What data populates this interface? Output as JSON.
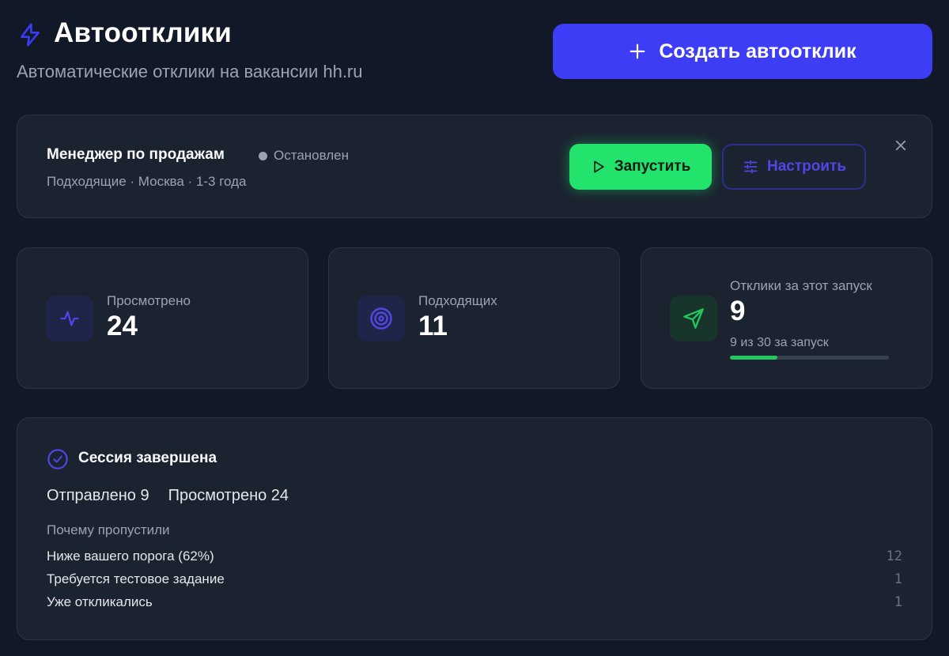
{
  "header": {
    "title": "Автоотклики",
    "subtitle": "Автоматические отклики на вакансии hh.ru",
    "create_label": "Создать автоотклик"
  },
  "job": {
    "title": "Менеджер по продажам",
    "status": "Остановлен",
    "meta": "Подходящие · Москва · 1-3 года",
    "run_label": "Запустить",
    "configure_label": "Настроить"
  },
  "stats": [
    {
      "label": "Просмотрено",
      "value": "24",
      "icon": "activity-icon"
    },
    {
      "label": "Подходящих",
      "value": "11",
      "icon": "target-icon"
    },
    {
      "label": "Отклики за этот запуск",
      "value": "9",
      "note": "9 из 30 за запуск",
      "progress": 0.3,
      "icon": "send-icon"
    }
  ],
  "session": {
    "title": "Сессия завершена",
    "sent": "Отправлено 9",
    "viewed": "Просмотрено 24",
    "skip_heading": "Почему пропустили",
    "reasons": [
      {
        "label": "Ниже вашего порога (62%)",
        "count": "12"
      },
      {
        "label": "Требуется тестовое задание",
        "count": "1"
      },
      {
        "label": "Уже откликались",
        "count": "1"
      }
    ]
  },
  "colors": {
    "accent": "#3d3df5",
    "run": "#22e36b",
    "background": "#111827",
    "card": "#1b2330",
    "progress": "#22c55e"
  }
}
